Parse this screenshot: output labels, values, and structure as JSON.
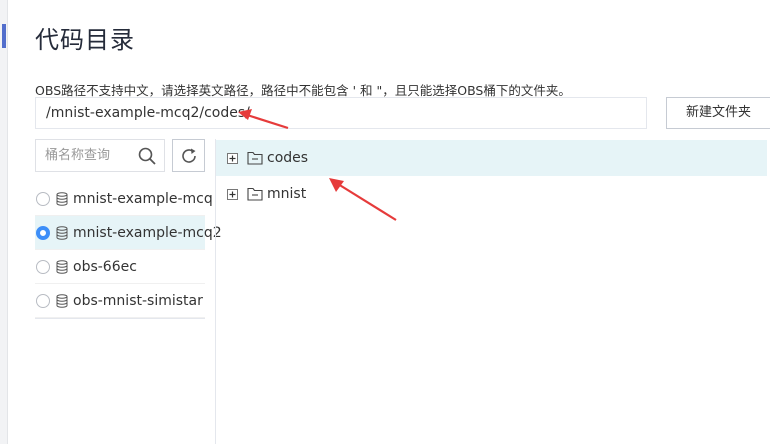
{
  "dialog": {
    "title": "代码目录",
    "note": "OBS路径不支持中文，请选择英文路径，路径中不能包含 ' 和 \"，且只能选择OBS桶下的文件夹。",
    "path_value": "/mnist-example-mcq2/codes/",
    "new_folder_label": "新建文件夹"
  },
  "search": {
    "placeholder": "桶名称查询"
  },
  "buckets": [
    {
      "name": "mnist-example-mcq",
      "selected": false
    },
    {
      "name": "mnist-example-mcq2",
      "selected": true
    },
    {
      "name": "obs-66ec",
      "selected": false
    },
    {
      "name": "obs-mnist-simistar",
      "selected": false
    }
  ],
  "folders": [
    {
      "name": "codes",
      "highlighted": true
    },
    {
      "name": "mnist",
      "highlighted": false
    }
  ],
  "colors": {
    "accent": "#3d8ef8",
    "selected_bg": "#e6f4f7",
    "annotation_arrow": "#e63b3b"
  }
}
